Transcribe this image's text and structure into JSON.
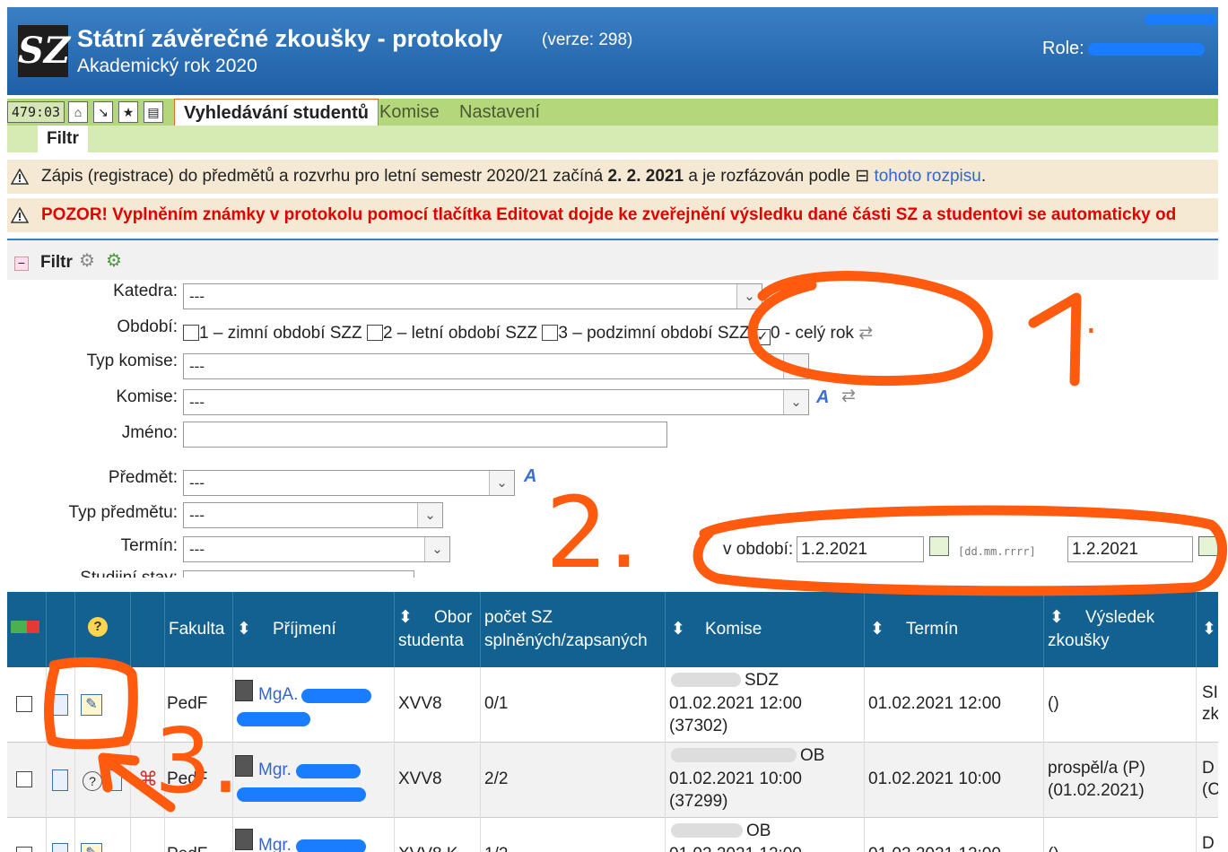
{
  "header": {
    "title": "Státní závěrečné zkoušky - protokoly",
    "version": "(verze: 298)",
    "year": "Akademický rok 2020",
    "role_label": "Role:",
    "logo": "SZ"
  },
  "menu": {
    "clock": "479:03",
    "active_tab": "Vyhledávání studentů",
    "items": [
      "Komise",
      "Nastavení"
    ],
    "sub_tab": "Filtr"
  },
  "notices": {
    "n1_pre": "Zápis (registrace) do předmětů a rozvrhu pro letní semestr 2020/21 začíná ",
    "n1_bold": "2. 2. 2021",
    "n1_mid": " a je rozfázován podle ",
    "n1_link": "tohoto rozpisu",
    "n1_end": ".",
    "n2": "POZOR! Vyplněním známky v protokolu pomocí tlačítka Editovat dojde ke zveřejnění výsledku dané části SZ a studentovi se automaticky od"
  },
  "filter": {
    "title": "Filtr",
    "katedra_label": "Katedra:",
    "katedra_value": "---",
    "obdobi_label": "Období:",
    "obdobi_options": [
      {
        "label": "1 – zimní období SZZ",
        "checked": false
      },
      {
        "label": "2 – letní období SZZ",
        "checked": false
      },
      {
        "label": "3 – podzimní období SZZ",
        "checked": false
      },
      {
        "label": "0 - celý rok",
        "checked": true
      }
    ],
    "typ_komise_label": "Typ komise:",
    "typ_komise_value": "---",
    "komise_label": "Komise:",
    "komise_value": "---",
    "jmeno_label": "Jméno:",
    "jmeno_value": "",
    "predmet_label": "Předmět:",
    "predmet_value": "---",
    "typ_predmetu_label": "Typ předmětu:",
    "typ_predmetu_value": "---",
    "termin_label": "Termín:",
    "termin_value": "---",
    "studijni_label": "Studijní stav:",
    "v_obdobi_label": "v období:",
    "date_from": "1.2.2021",
    "date_format": "[dd.mm.rrrr]",
    "date_to": "1.2.2021"
  },
  "table": {
    "headers": {
      "fakulta": "Fakulta",
      "prijmeni": "Příjmení",
      "obor": "Obor",
      "obor2": "studenta",
      "pocet": "počet SZ",
      "pocet2": "splněných/zapsaných",
      "komise": "Komise",
      "termin": "Termín",
      "vysledek": "Výsledek",
      "vysledek2": "zkoušky"
    },
    "rows": [
      {
        "fakulta": "PedF",
        "titul": "MgA.",
        "obor": "XVV8",
        "pocet": "0/1",
        "komise1": "SDZ",
        "komise2": "01.02.2021 12:00",
        "komise3": "(37302)",
        "termin": "01.02.2021 12:00",
        "vysledek1": "()",
        "vysledek2": "",
        "extra1": "SI",
        "extra2": "zk"
      },
      {
        "fakulta": "PedF",
        "titul": "Mgr.",
        "obor": "XVV8",
        "pocet": "2/2",
        "komise1": "OB",
        "komise2": "01.02.2021 10:00",
        "komise3": "(37299)",
        "termin": "01.02.2021 10:00",
        "vysledek1": "prospěl/a (P)",
        "vysledek2": "(01.02.2021)",
        "extra1": "D",
        "extra2": "(C"
      },
      {
        "fakulta": "PedF",
        "titul": "Mgr.",
        "obor": "XVV8 K",
        "pocet": "1/2",
        "komise1": "OB",
        "komise2": "01.02.2021 12:00",
        "komise3": "",
        "termin": "01.02.2021 12:00",
        "vysledek1": "()",
        "vysledek2": "",
        "extra1": "D",
        "extra2": ""
      }
    ]
  },
  "annotations": [
    "1.",
    "2.",
    "3."
  ],
  "colors": {
    "header": "#2a6cb3",
    "menu": "#b5d77c",
    "annotation": "#ff5a0e",
    "table_head": "#126191"
  }
}
